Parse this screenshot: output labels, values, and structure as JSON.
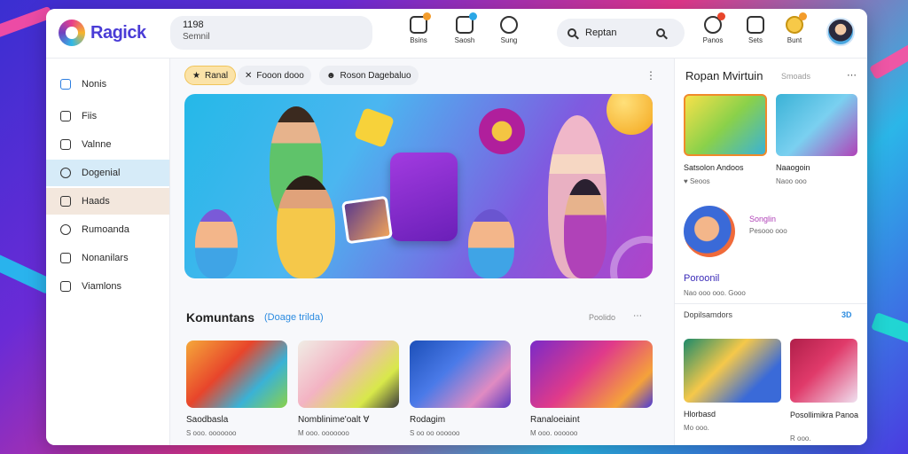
{
  "app": {
    "logo_text": "Ragick"
  },
  "header": {
    "account_number": "1198",
    "account_label": "Semnil",
    "nav": [
      {
        "label": "Bsins",
        "icon": "bell-icon",
        "badge": "#f39c2b"
      },
      {
        "label": "Saosh",
        "icon": "music-note-icon",
        "badge": "#2aa7e6"
      },
      {
        "label": "Sung",
        "icon": "play-circle-icon",
        "badge": ""
      }
    ],
    "search_value": "Reptan",
    "right_nav": [
      {
        "label": "Panos",
        "icon": "chat-icon",
        "badge": "#e8452b"
      },
      {
        "label": "Sets",
        "icon": "gift-icon",
        "badge": ""
      },
      {
        "label": "Bunt",
        "icon": "trophy-icon",
        "badge": "#f39c2b"
      }
    ]
  },
  "sidebar": {
    "items": [
      {
        "label": "Nonis",
        "icon": "home-icon"
      },
      {
        "label": "Fiis",
        "icon": "house-icon"
      },
      {
        "label": "Valnne",
        "icon": "folder-icon"
      },
      {
        "label": "Dogenial",
        "icon": "search-icon"
      },
      {
        "label": "Haads",
        "icon": "grid-icon"
      },
      {
        "label": "Rumoanda",
        "icon": "compass-icon"
      },
      {
        "label": "Nonanilars",
        "icon": "bookmark-icon"
      },
      {
        "label": "Viamlons",
        "icon": "mail-icon"
      }
    ]
  },
  "main": {
    "chips": [
      {
        "label": "Ranal",
        "icon": "star-icon"
      },
      {
        "label": "Fooon dooo",
        "icon": "close-icon"
      },
      {
        "label": "Roson  Dagebaluo",
        "icon": "user-icon"
      }
    ],
    "section_title": "Komuntans",
    "section_link": "(Doage trilda)",
    "section_more": "Poolido",
    "cards": [
      {
        "title": "Saodbasla",
        "meta": "S ooo. ooooooo"
      },
      {
        "title": "Nomblinime'oalt ∀",
        "meta": "M ooo. ooooooo"
      },
      {
        "title": "Rodagim",
        "meta": "S oo oo oooooo"
      },
      {
        "title": "Ranaloeiaint",
        "meta": "M ooo. oooooo"
      }
    ]
  },
  "right_panel": {
    "title": "Ropan Mvirtuin",
    "subtitle": "Smoads",
    "items": [
      {
        "title": "Satsolon Andoos",
        "meta": "♥ Seoos"
      },
      {
        "title": "Naaogoin",
        "meta": "Naoo ooo"
      }
    ],
    "person_name": "Songlin",
    "person_meta": "Pesooo ooo",
    "section_label": "Poroonil",
    "section_meta": "Nao ooo ooo. Gooo",
    "list_label": "Dopilsamdors",
    "list_count": "3D",
    "bottom": [
      {
        "title": "Hlorbasd",
        "meta": "Mo ooo."
      },
      {
        "title": "Posollimikra Panoa",
        "meta": "R ooo."
      }
    ]
  },
  "colors": {
    "accent": "#4a3cd6",
    "link": "#2b8be0",
    "sidebar_active": "#d6ebf8"
  }
}
